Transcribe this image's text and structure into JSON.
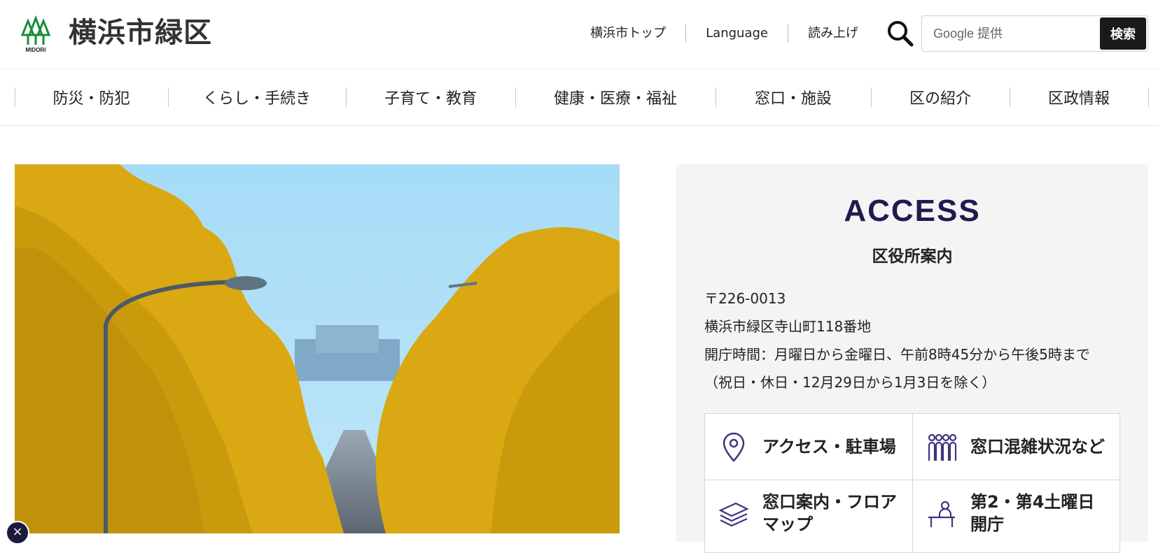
{
  "header": {
    "site_title": "横浜市緑区",
    "logo_text": "MIDORI",
    "util_links": [
      "横浜市トップ",
      "Language",
      "読み上げ"
    ],
    "search_placeholder": "Google 提供",
    "search_button": "検索"
  },
  "gnav": [
    "防災・防犯",
    "くらし・手続き",
    "子育て・教育",
    "健康・医療・福祉",
    "窓口・施設",
    "区の紹介",
    "区政情報"
  ],
  "access": {
    "title": "ACCESS",
    "subtitle": "区役所案内",
    "postal": "〒226-0013",
    "address": "横浜市緑区寺山町118番地",
    "hours": "開庁時間：月曜日から金曜日、午前8時45分から午後5時まで",
    "hours_note": "（祝日・休日・12月29日から1月3日を除く）",
    "links": [
      {
        "label": "アクセス・駐車場",
        "icon": "map-pin-icon"
      },
      {
        "label": "窓口混雑状況など",
        "icon": "people-queue-icon"
      },
      {
        "label": "窓口案内・フロアマップ",
        "icon": "layers-icon"
      },
      {
        "label": "第2・第4土曜日開庁",
        "icon": "reception-desk-icon"
      }
    ]
  },
  "colors": {
    "logo_green": "#1a8a3a",
    "accent_navy": "#1f1b4e",
    "panel_bg": "#f4f4f4",
    "foliage_yellow": "#d9a812",
    "sky_blue": "#a6dcf7"
  }
}
